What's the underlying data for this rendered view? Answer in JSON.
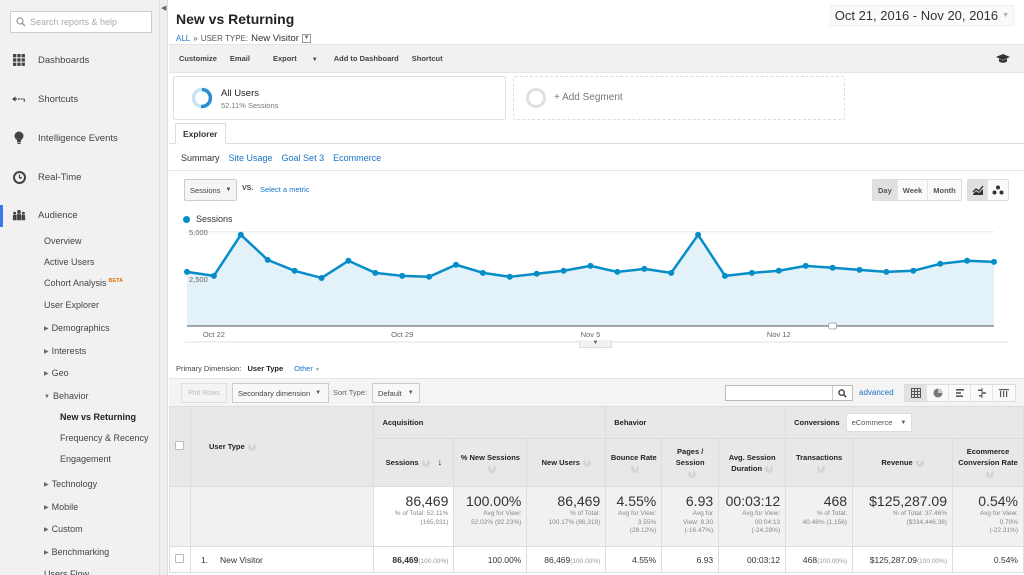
{
  "sidebar": {
    "search_placeholder": "Search reports & help",
    "main_items": [
      {
        "label": "Dashboards",
        "icon": "dashboard-grid-icon"
      },
      {
        "label": "Shortcuts",
        "icon": "shortcut-arrow-icon"
      },
      {
        "label": "Intelligence Events",
        "icon": "lightbulb-icon"
      },
      {
        "label": "Real-Time",
        "icon": "clock-icon"
      },
      {
        "label": "Audience",
        "icon": "people-icon"
      }
    ],
    "audience_items": [
      {
        "label": "Overview"
      },
      {
        "label": "Active Users"
      },
      {
        "label": "Cohort Analysis",
        "badge": "BETA"
      },
      {
        "label": "User Explorer"
      },
      {
        "label": "Demographics",
        "expandable": true
      },
      {
        "label": "Interests",
        "expandable": true
      },
      {
        "label": "Geo",
        "expandable": true
      },
      {
        "label": "Behavior",
        "expanded": true
      },
      {
        "label": "New vs Returning",
        "current": true
      },
      {
        "label": "Frequency & Recency"
      },
      {
        "label": "Engagement"
      },
      {
        "label": "Technology",
        "expandable": true
      },
      {
        "label": "Mobile",
        "expandable": true
      },
      {
        "label": "Custom",
        "expandable": true
      },
      {
        "label": "Benchmarking",
        "expandable": true
      },
      {
        "label": "Users Flow"
      }
    ]
  },
  "header": {
    "title": "New vs Returning",
    "breadcrumb_all": "ALL",
    "breadcrumb_sep": "»",
    "breadcrumb_key": "USER TYPE:",
    "breadcrumb_value": "New Visitor",
    "date_range": "Oct 21, 2016 - Nov 20, 2016"
  },
  "toolbar": {
    "customize": "Customize",
    "email": "Email",
    "export": "Export",
    "add_to_dashboard": "Add to Dashboard",
    "shortcut": "Shortcut"
  },
  "segments": {
    "active": {
      "name": "All Users",
      "detail": "52.11% Sessions"
    },
    "add": "+ Add Segment"
  },
  "explorer": {
    "tab": "Explorer",
    "subtabs": [
      "Summary",
      "Site Usage",
      "Goal Set 3",
      "Ecommerce"
    ],
    "metric": "Sessions",
    "vs": "VS.",
    "select_metric": "Select a metric",
    "periods": [
      "Day",
      "Week",
      "Month"
    ],
    "selected_period": "Day"
  },
  "chart_data": {
    "type": "area",
    "series": [
      {
        "name": "Sessions",
        "color": "#058dc7",
        "values": [
          2870,
          2660,
          4840,
          3510,
          2930,
          2550,
          3460,
          2820,
          2660,
          2610,
          3250,
          2820,
          2610,
          2770,
          2930,
          3190,
          2870,
          3030,
          2820,
          4840,
          2660,
          2820,
          2930,
          3190,
          3090,
          2980,
          2870,
          2930,
          3300,
          3460,
          3400
        ]
      }
    ],
    "x": [
      "Oct 21",
      "Oct 22",
      "Oct 23",
      "Oct 24",
      "Oct 25",
      "Oct 26",
      "Oct 27",
      "Oct 28",
      "Oct 29",
      "Oct 30",
      "Oct 31",
      "Nov 1",
      "Nov 2",
      "Nov 3",
      "Nov 4",
      "Nov 5",
      "Nov 6",
      "Nov 7",
      "Nov 8",
      "Nov 9",
      "Nov 10",
      "Nov 11",
      "Nov 12",
      "Nov 13",
      "Nov 14",
      "Nov 15",
      "Nov 16",
      "Nov 17",
      "Nov 18",
      "Nov 19",
      "Nov 20"
    ],
    "x_tick_labels": [
      {
        "index": 1,
        "label": "Oct 22"
      },
      {
        "index": 8,
        "label": "Oct 29"
      },
      {
        "index": 15,
        "label": "Nov 5"
      },
      {
        "index": 22,
        "label": "Nov 12"
      }
    ],
    "y_tick_labels": [
      "2,500",
      "5,000"
    ],
    "y_ticks": [
      2500,
      5000
    ],
    "ylim": [
      0,
      5200
    ],
    "legend": "top-left",
    "grid": true,
    "title": "",
    "xlabel": "",
    "ylabel": ""
  },
  "table_controls": {
    "primary_dimension_label": "Primary Dimension:",
    "primary_dimension_value": "User Type",
    "other": "Other",
    "plot_rows": "Plot Rows",
    "secondary_dimension": "Secondary dimension",
    "sort_type_label": "Sort Type:",
    "sort_type_value": "Default",
    "search_value": "",
    "advanced": "advanced"
  },
  "table": {
    "dimension_header": "User Type",
    "groups": {
      "acquisition": "Acquisition",
      "behavior": "Behavior",
      "conversions": "Conversions",
      "conversions_select": "eCommerce"
    },
    "columns": [
      "Sessions",
      "% New Sessions",
      "New Users",
      "Bounce Rate",
      "Pages / Session",
      "Avg. Session Duration",
      "Transactions",
      "Revenue",
      "Ecommerce Conversion Rate"
    ],
    "totals": [
      {
        "value": "86,469",
        "sub1": "% of Total: 52.11%",
        "sub2": "(165,931)"
      },
      {
        "value": "100.00%",
        "sub1": "Avg for View:",
        "sub2": "52.02% (92.23%)"
      },
      {
        "value": "86,469",
        "sub1": "% of Total:",
        "sub2": "100.17% (86,319)"
      },
      {
        "value": "4.55%",
        "sub1": "Avg for View:",
        "sub2": "3.55%",
        "sub3": "(28.12%)"
      },
      {
        "value": "6.93",
        "sub1": "Avg for",
        "sub2": "View: 8.30",
        "sub3": "(-16.47%)"
      },
      {
        "value": "00:03:12",
        "sub1": "Avg for View:",
        "sub2": "00:04:13",
        "sub3": "(-24.28%)"
      },
      {
        "value": "468",
        "sub1": "% of Total:",
        "sub2": "40.48% (1,156)"
      },
      {
        "value": "$125,287.09",
        "sub1": "% of Total: 37.46%",
        "sub2": "($334,446.38)"
      },
      {
        "value": "0.54%",
        "sub1": "Avg for View:",
        "sub2": "0.70%",
        "sub3": "(-22.31%)"
      }
    ],
    "rows": [
      {
        "index": "1.",
        "user_type": "New Visitor",
        "sessions": "86,469",
        "sessions_pct": "(100.00%)",
        "pct_new_sessions": "100.00%",
        "new_users": "86,469",
        "new_users_pct": "(100.00%)",
        "bounce_rate": "4.55%",
        "pages_per_session": "6.93",
        "avg_session_duration": "00:03:12",
        "transactions": "468",
        "transactions_pct": "(100.00%)",
        "revenue": "$125,287.09",
        "revenue_pct": "(100.00%)",
        "conversion_rate": "0.54%"
      }
    ]
  }
}
